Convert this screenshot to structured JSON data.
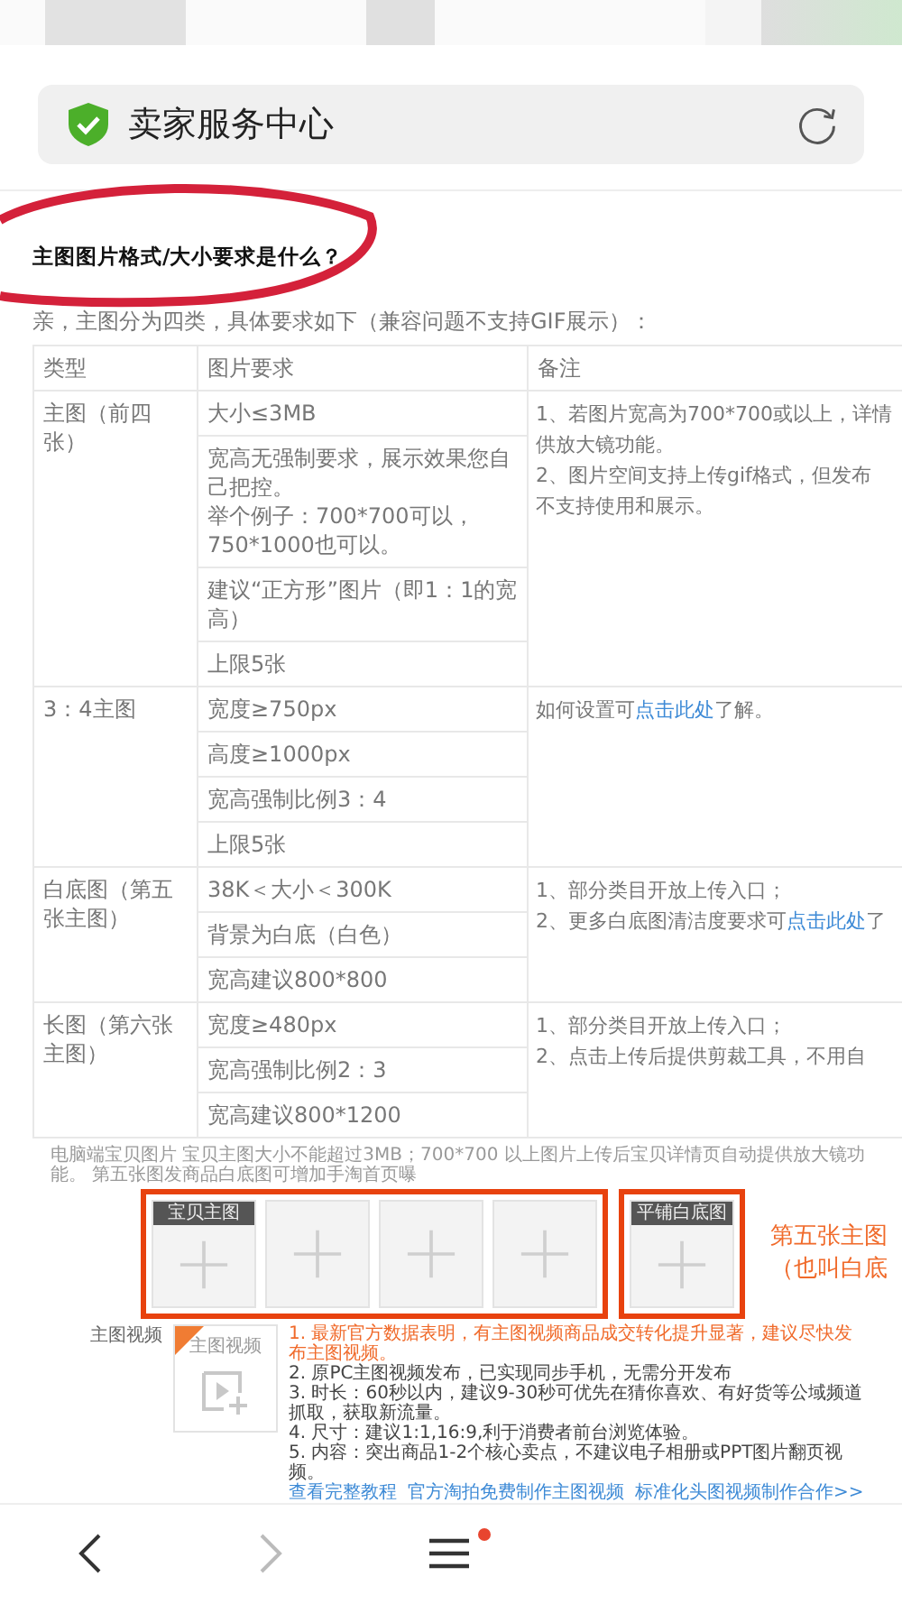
{
  "address_bar": {
    "title": "卖家服务中心",
    "secure": true
  },
  "article": {
    "title": "主图图片格式/大小要求是什么？",
    "intro": "亲，主图分为四类，具体要求如下（兼容问题不支持GIF展示）：",
    "table": {
      "columns": [
        "类型",
        "图片要求",
        "备注"
      ],
      "rows": [
        {
          "type": "主图（前四张）",
          "requirements": [
            [
              "大小≤3MB"
            ],
            [
              "宽高无强制要求，展示效果您自己把控。",
              "举个例子：700*700可以，750*1000也可以。"
            ],
            [
              "建议“正方形”图片（即1：1的宽高）"
            ],
            [
              "上限5张"
            ]
          ],
          "notes": [
            {
              "lines": [
                [
                  {
                    "text": "1、若图片宽高为700*700或以上，详情",
                    "link": false
                  }
                ],
                [
                  {
                    "text": "供放大镜功能。",
                    "link": false
                  }
                ]
              ]
            },
            {
              "lines": [
                [
                  {
                    "text": "2、图片空间支持上传gif格式，但发布",
                    "link": false
                  }
                ],
                [
                  {
                    "text": "不支持使用和展示。",
                    "link": false
                  }
                ]
              ]
            }
          ]
        },
        {
          "type": "3：4主图",
          "requirements": [
            [
              "宽度≥750px"
            ],
            [
              "高度≥1000px"
            ],
            [
              "宽高强制比例3：4"
            ],
            [
              "上限5张"
            ]
          ],
          "notes": [
            {
              "lines": [
                [
                  {
                    "text": "如何设置可",
                    "link": false
                  },
                  {
                    "text": "点击此处",
                    "link": true
                  },
                  {
                    "text": "了解。",
                    "link": false
                  }
                ]
              ]
            }
          ]
        },
        {
          "type": "白底图（第五张主图）",
          "requirements": [
            [
              "38K＜大小＜300K"
            ],
            [
              "背景为白底（白色）"
            ],
            [
              "宽高建议800*800"
            ]
          ],
          "notes": [
            {
              "lines": [
                [
                  {
                    "text": "1、部分类目开放上传入口；",
                    "link": false
                  }
                ]
              ]
            },
            {
              "lines": [
                [
                  {
                    "text": "2、更多白底图清洁度要求可",
                    "link": false
                  },
                  {
                    "text": "点击此处",
                    "link": true
                  },
                  {
                    "text": "了",
                    "link": false
                  }
                ]
              ]
            }
          ]
        },
        {
          "type": "长图（第六张主图）",
          "requirements": [
            [
              "宽度≥480px"
            ],
            [
              "宽高强制比例2：3"
            ],
            [
              "宽高建议800*1200"
            ]
          ],
          "notes": [
            {
              "lines": [
                [
                  {
                    "text": "1、部分类目开放上传入口；",
                    "link": false
                  }
                ]
              ]
            },
            {
              "lines": [
                [
                  {
                    "text": "2、点击上传后提供剪裁工具，不用自",
                    "link": false
                  }
                ]
              ]
            }
          ]
        }
      ]
    }
  },
  "screenshot": {
    "note": "电脑端宝贝图片 宝贝主图大小不能超过3MB；700*700 以上图片上传后宝贝详情页自动提供放大镜功能。 第五张图发商品白底图可增加手淘首页曝",
    "slot_groups": [
      {
        "slots": [
          {
            "kind": "labeled",
            "label": "宝贝主图"
          },
          {
            "kind": "plain"
          },
          {
            "kind": "plain"
          },
          {
            "kind": "plain"
          }
        ]
      },
      {
        "slots": [
          {
            "kind": "labeled",
            "label": "平铺白底图"
          }
        ]
      }
    ],
    "caption": [
      "第五张主图",
      "（也叫白底"
    ],
    "video": {
      "label": "主图视频",
      "box_label": "主图视频",
      "tips": [
        {
          "text": "1. 最新官方数据表明，有主图视频商品成交转化提升显著，建议尽快发布主图视频。",
          "highlight": true
        },
        {
          "text": "2. 原PC主图视频发布，已实现同步手机，无需分开发布",
          "highlight": false
        },
        {
          "text": "3. 时长：60秒以内，建议9-30秒可优先在猜你喜欢、有好货等公域频道抓取，获取新流量。",
          "highlight": false
        },
        {
          "text": "4. 尺寸：建议1:1,16:9,利于消费者前台浏览体验。",
          "highlight": false
        },
        {
          "text": "5. 内容：突出商品1-2个核心卖点，不建议电子相册或PPT图片翻页视频。",
          "highlight": false
        }
      ],
      "links": [
        "查看完整教程",
        "官方淘拍免费制作主图视频",
        "标准化头图视频制作合作>>"
      ]
    }
  },
  "nav": [
    {
      "kind": "back",
      "disabled": false,
      "badge": false
    },
    {
      "kind": "forward",
      "disabled": true,
      "badge": false
    },
    {
      "kind": "menu",
      "disabled": false,
      "badge": true
    }
  ]
}
